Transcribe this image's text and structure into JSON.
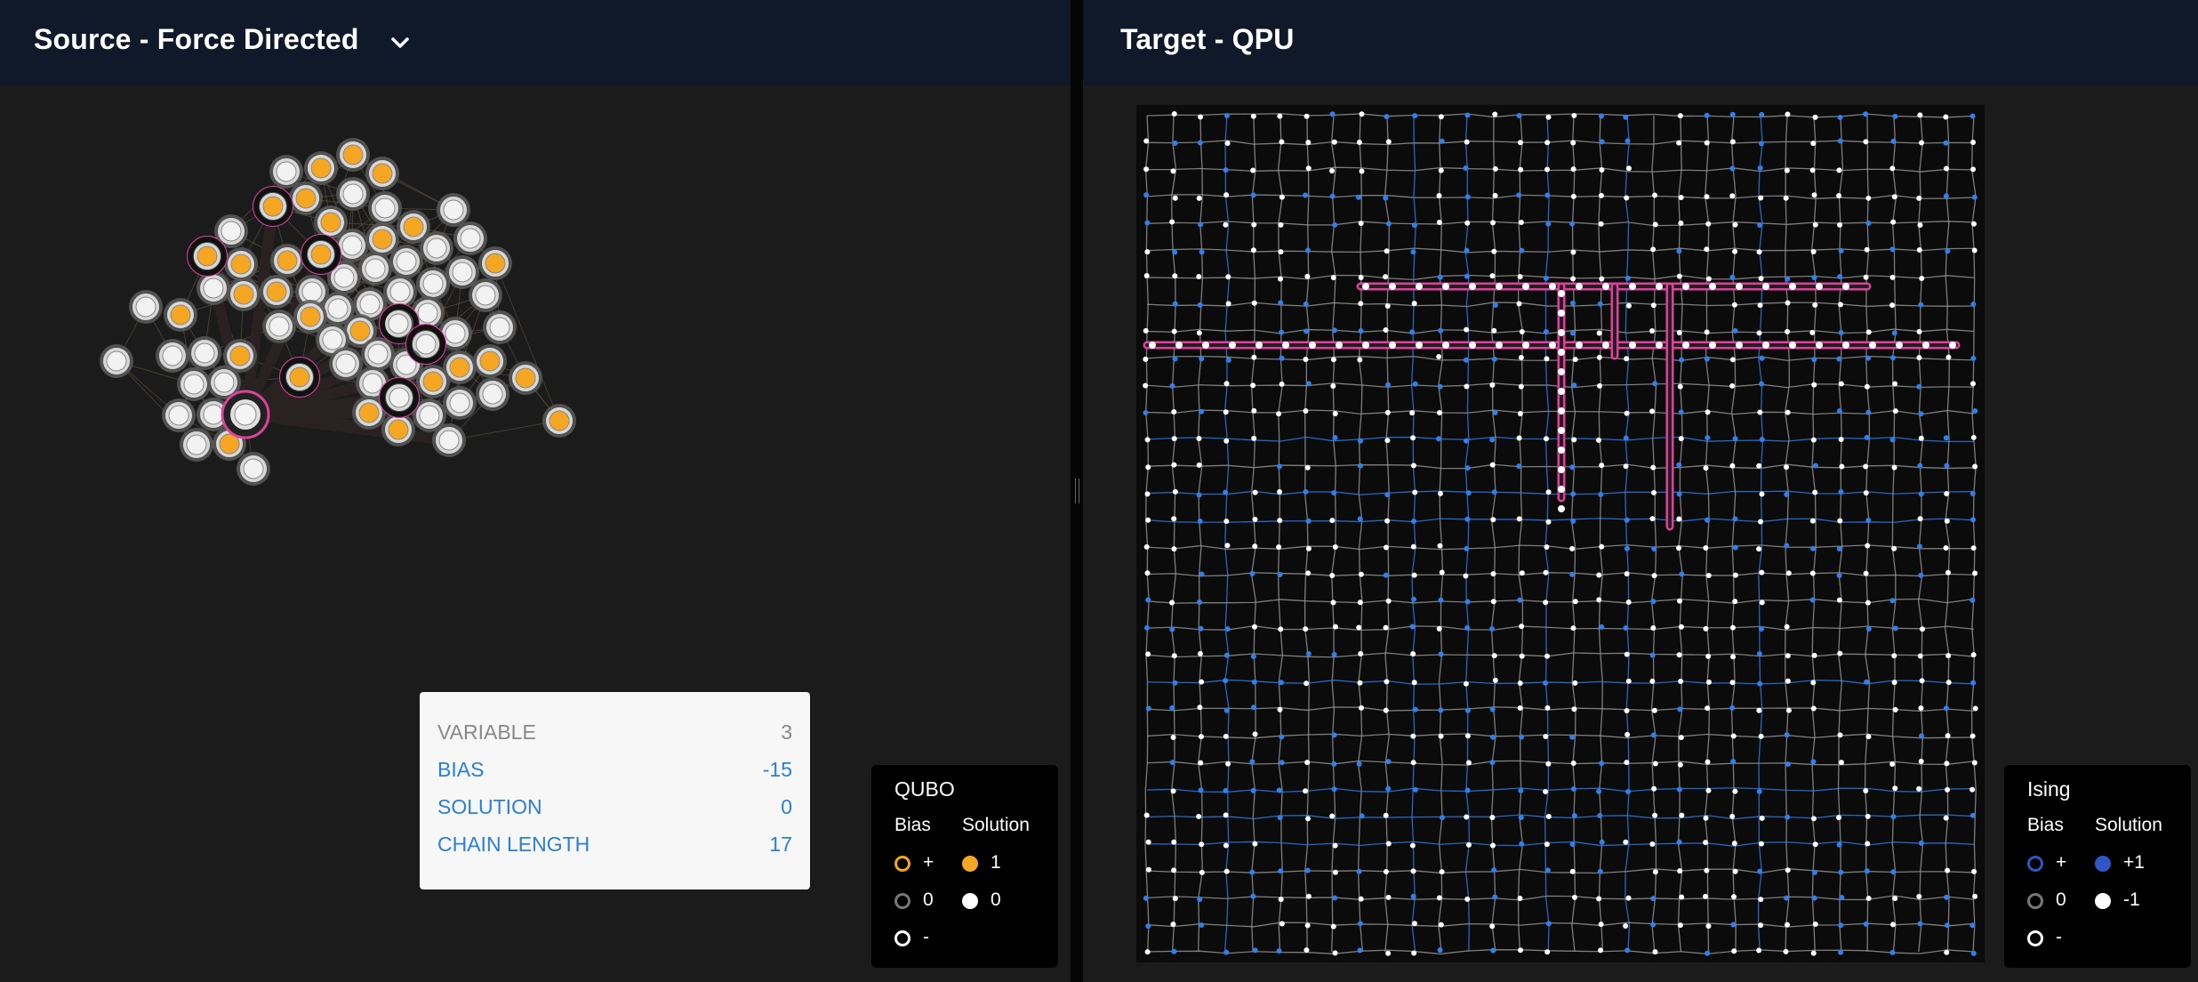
{
  "source_panel": {
    "title": "Source - Force Directed",
    "dropdown_icon": "chevron-down-icon"
  },
  "target_panel": {
    "title": "Target - QPU"
  },
  "tooltip": {
    "rows": [
      {
        "key": "VARIABLE",
        "value": "3"
      },
      {
        "key": "BIAS",
        "value": "-15"
      },
      {
        "key": "SOLUTION",
        "value": "0"
      },
      {
        "key": "CHAIN LENGTH",
        "value": "17"
      }
    ]
  },
  "qubo_legend": {
    "title": "QUBO",
    "bias_header": "Bias",
    "solution_header": "Solution",
    "bias_items": [
      "+",
      "0",
      "-"
    ],
    "solution_items": [
      "1",
      "0"
    ]
  },
  "ising_legend": {
    "title": "Ising",
    "bias_header": "Bias",
    "solution_header": "Solution",
    "bias_items": [
      "+",
      "0",
      "-"
    ],
    "solution_items": [
      "+1",
      "-1"
    ]
  },
  "colors": {
    "header_bg": "#0f1929",
    "panel_bg": "#1b1b1b",
    "node_orange": "#f5a623",
    "chain_pink": "#d9449a",
    "qpu_blue": "#2f80ed",
    "tooltip_label_blue": "#2b7fd6"
  }
}
